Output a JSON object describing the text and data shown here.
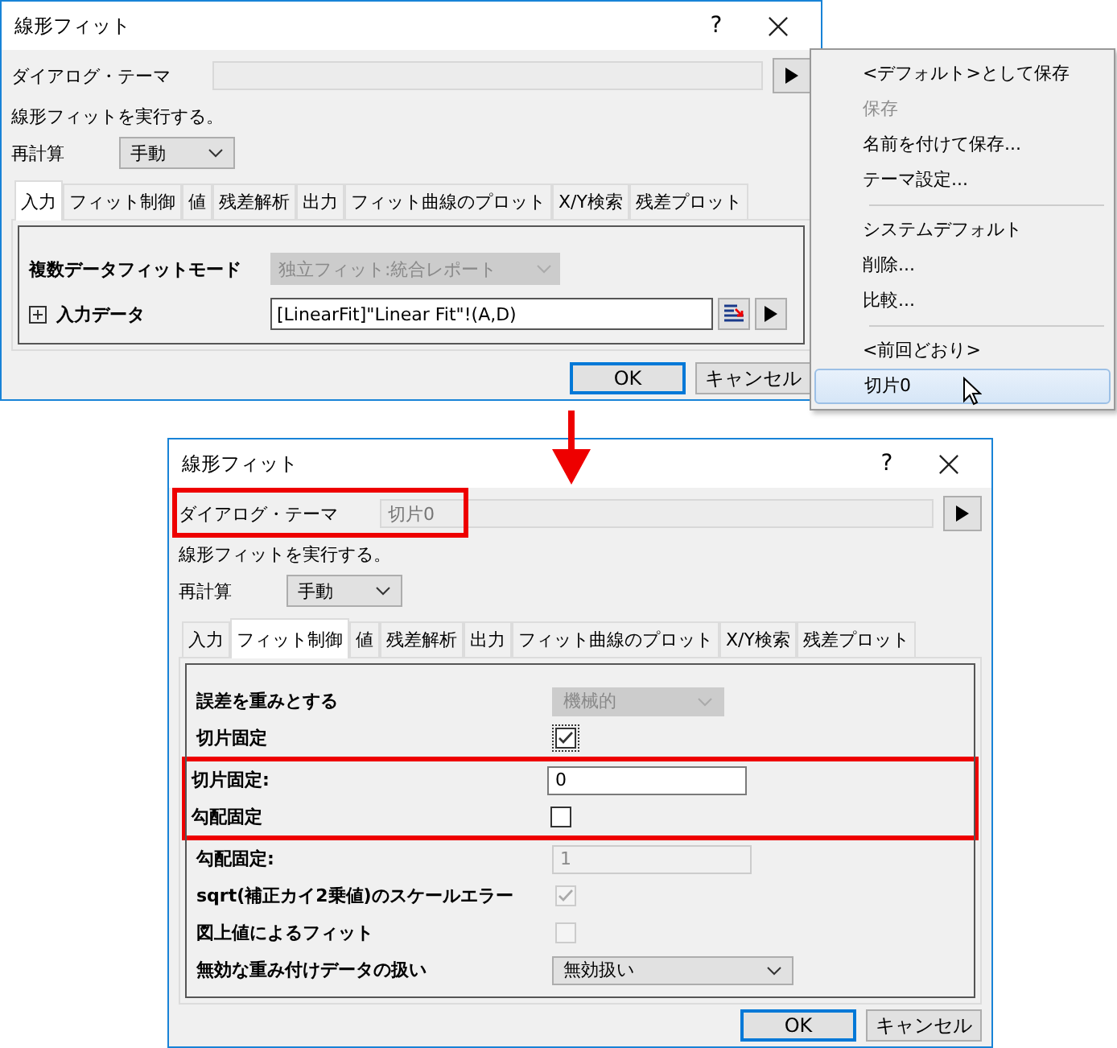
{
  "dialogs": [
    {
      "title": "線形フィット",
      "help": "?",
      "theme_label": "ダイアログ・テーマ",
      "description": "線形フィットを実行する。",
      "recalc_label": "再計算",
      "recalc_value": "手動",
      "tabs": [
        {
          "label": "入力",
          "selected": true
        },
        {
          "label": "フィット制御",
          "selected": false
        },
        {
          "label": "値",
          "selected": false
        },
        {
          "label": "残差解析",
          "selected": false
        },
        {
          "label": "出力",
          "selected": false
        },
        {
          "label": "フィット曲線のプロット",
          "selected": false
        },
        {
          "label": "X/Y検索",
          "selected": false
        },
        {
          "label": "残差プロット",
          "selected": false
        }
      ],
      "row_groups": [
        {
          "highlighted": false,
          "rows": [
            {
              "kind": "combo",
              "label": "複数データフィットモード",
              "value": "独立フィット:統合レポート",
              "disabled": true
            },
            {
              "kind": "data",
              "label": "入力データ",
              "value": "[LinearFit]\"Linear Fit\"!(A,D)",
              "expanded": false
            }
          ]
        }
      ],
      "buttons": [
        {
          "label": "OK",
          "default": true
        },
        {
          "label": "キャンセル",
          "default": false
        }
      ]
    },
    {
      "title": "線形フィット",
      "help": "?",
      "theme_label": "ダイアログ・テーマ",
      "theme_value": "切片0",
      "theme_highlighted": true,
      "description": "線形フィットを実行する。",
      "recalc_label": "再計算",
      "recalc_value": "手動",
      "tabs": [
        {
          "label": "入力",
          "selected": false
        },
        {
          "label": "フィット制御",
          "selected": true
        },
        {
          "label": "値",
          "selected": false
        },
        {
          "label": "残差解析",
          "selected": false
        },
        {
          "label": "出力",
          "selected": false
        },
        {
          "label": "フィット曲線のプロット",
          "selected": false
        },
        {
          "label": "X/Y検索",
          "selected": false
        },
        {
          "label": "残差プロット",
          "selected": false
        }
      ],
      "row_groups": [
        {
          "highlighted": false,
          "rows": [
            {
              "kind": "combo",
              "label": "誤差を重みとする",
              "value": "機械的",
              "disabled": true
            },
            {
              "kind": "checkbox",
              "label": "切片固定",
              "checked": true,
              "disabled": false,
              "focused": true
            }
          ]
        },
        {
          "highlighted": true,
          "rows": [
            {
              "kind": "text",
              "label": "切片固定:",
              "value": "0",
              "disabled": false
            },
            {
              "kind": "checkbox",
              "label": "勾配固定",
              "checked": false,
              "disabled": false,
              "focused": false
            }
          ]
        },
        {
          "highlighted": false,
          "rows": [
            {
              "kind": "text",
              "label": "勾配固定:",
              "value": "1",
              "disabled": true
            },
            {
              "kind": "checkbox",
              "label": "sqrt(補正カイ2乗値)のスケールエラー",
              "checked": true,
              "disabled": true,
              "focused": false
            },
            {
              "kind": "checkbox",
              "label": "図上値によるフィット",
              "checked": false,
              "disabled": true,
              "focused": false
            },
            {
              "kind": "combo",
              "label": "無効な重み付けデータの扱い",
              "value": "無効扱い",
              "disabled": false
            }
          ]
        }
      ],
      "buttons": [
        {
          "label": "OK",
          "default": true
        },
        {
          "label": "キャンセル",
          "default": false
        }
      ]
    }
  ],
  "menu": {
    "groups": [
      [
        {
          "label": "<デフォルト>として保存",
          "disabled": false,
          "selected": false
        },
        {
          "label": "保存",
          "disabled": true,
          "selected": false
        },
        {
          "label": "名前を付けて保存...",
          "disabled": false,
          "selected": false
        },
        {
          "label": "テーマ設定...",
          "disabled": false,
          "selected": false
        }
      ],
      [
        {
          "label": "システムデフォルト",
          "disabled": false,
          "selected": false
        },
        {
          "label": "削除...",
          "disabled": false,
          "selected": false
        },
        {
          "label": "比較...",
          "disabled": false,
          "selected": false
        }
      ],
      [
        {
          "label": "<前回どおり>",
          "disabled": false,
          "selected": false
        },
        {
          "label": "切片0",
          "disabled": false,
          "selected": true
        }
      ]
    ]
  }
}
